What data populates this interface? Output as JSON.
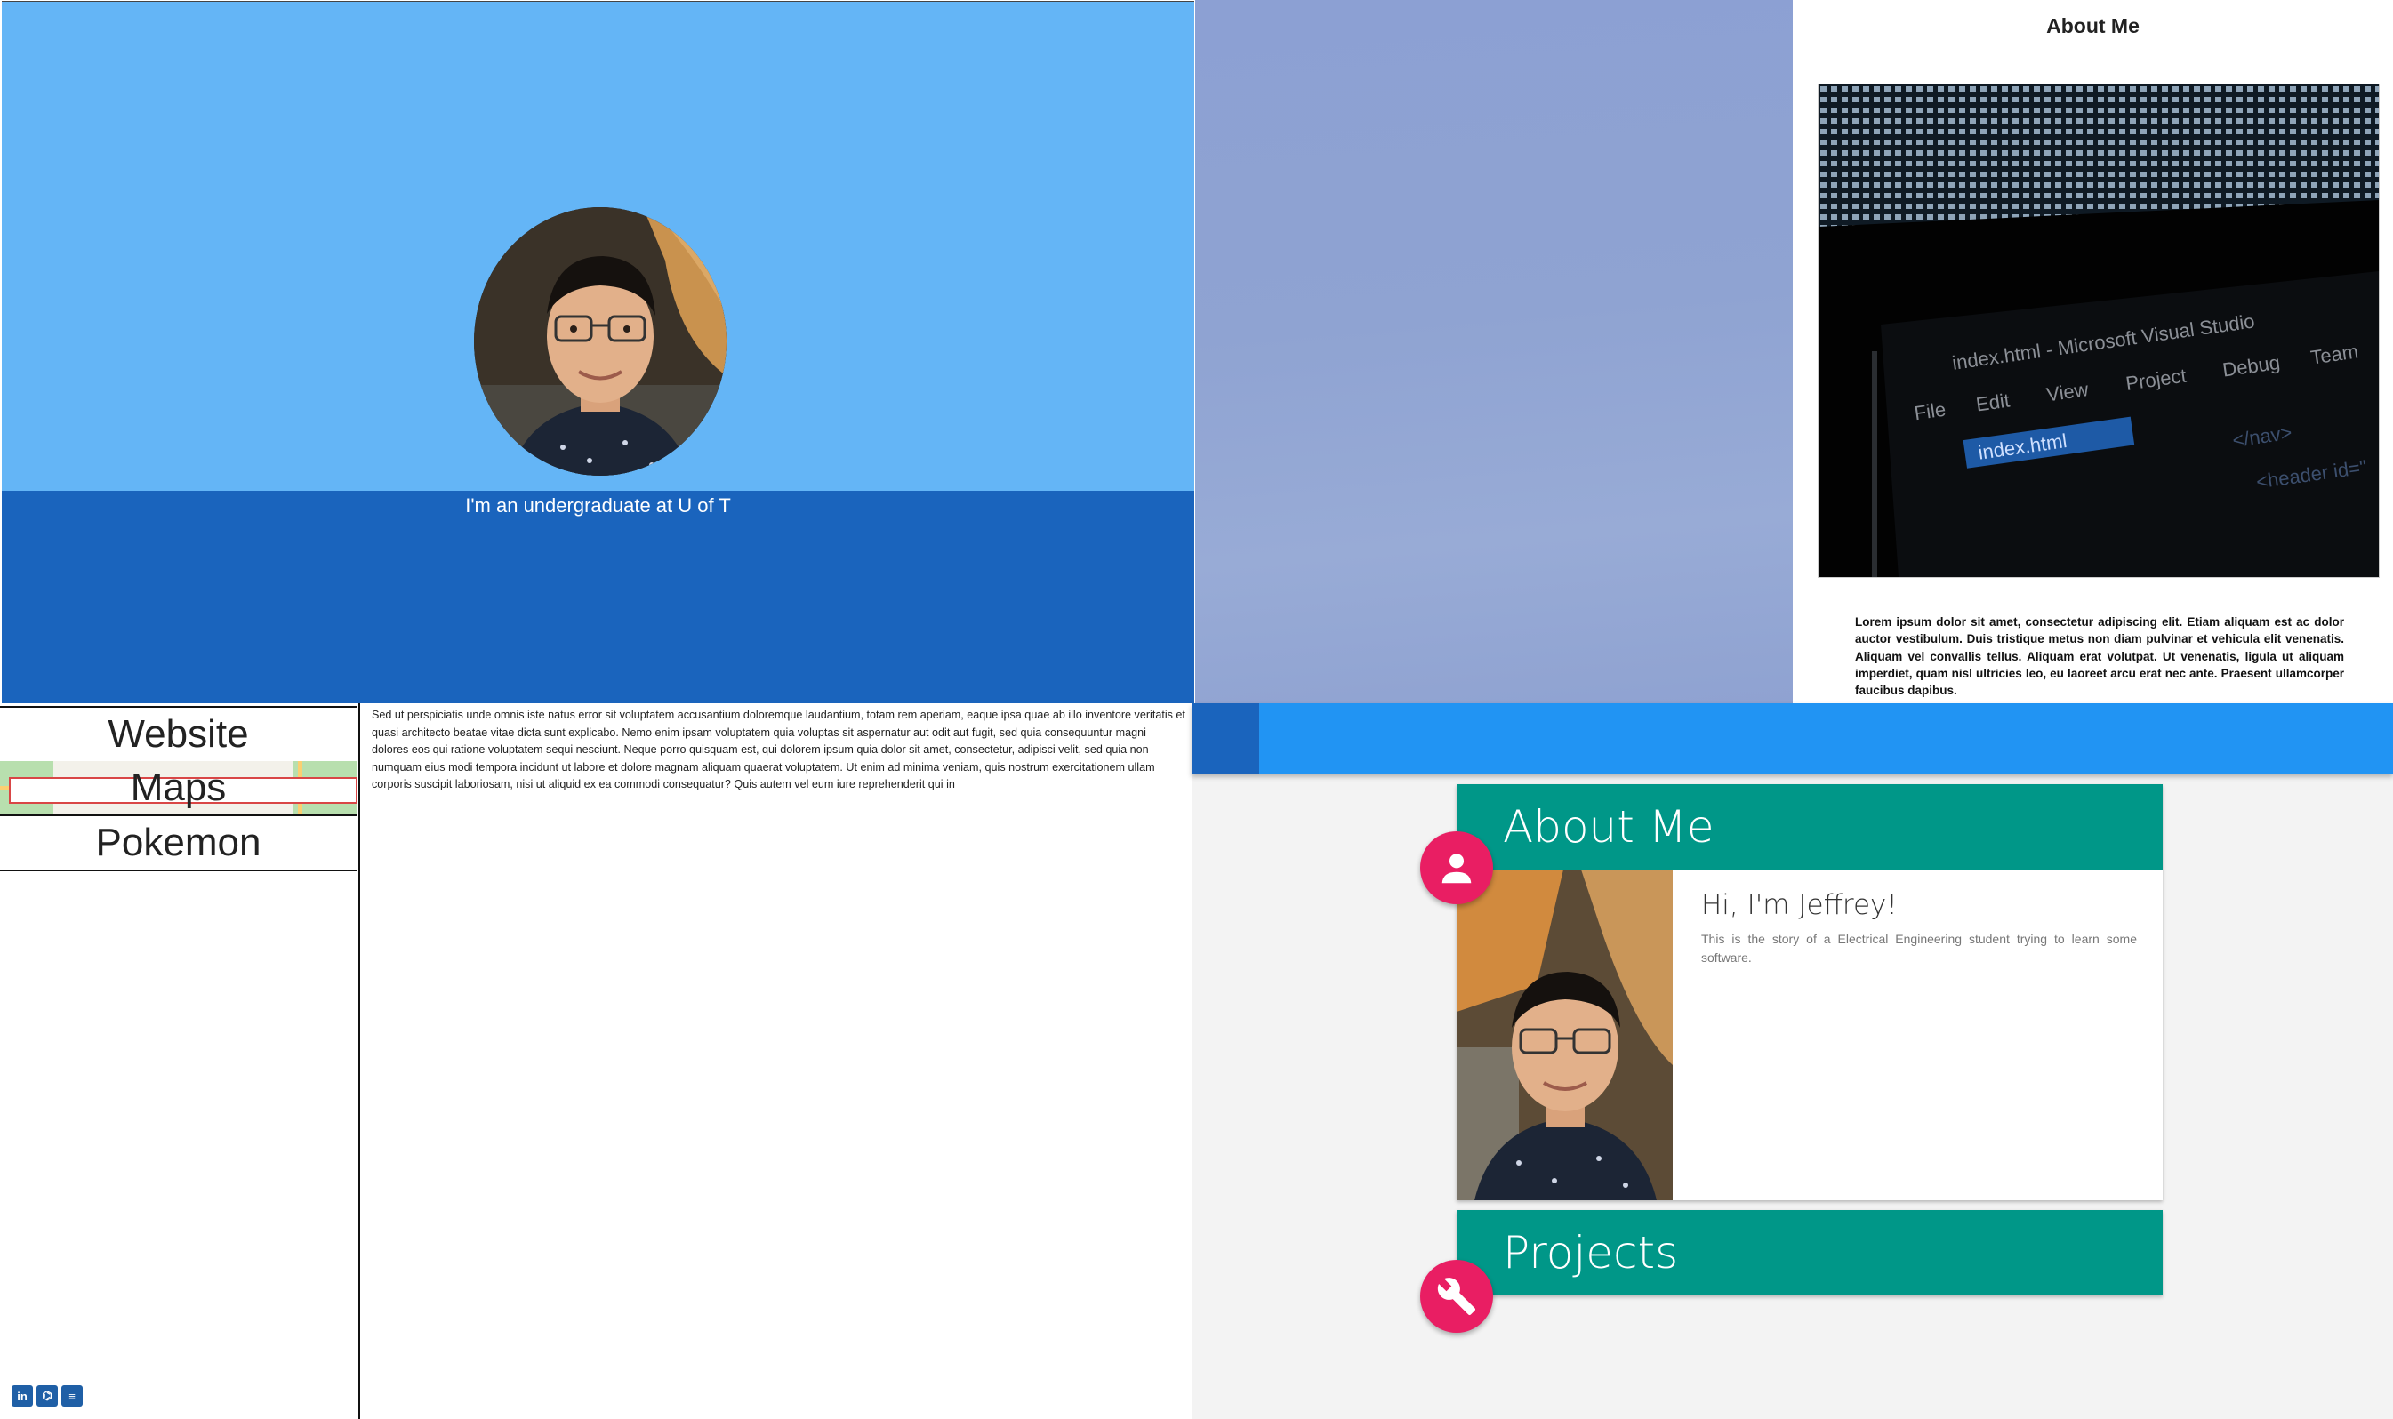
{
  "hero": {
    "caption": "I'm an undergraduate at U of T",
    "colors": {
      "top": "#64b5f6",
      "bottom": "#1a64bd"
    }
  },
  "about_panel": {
    "title": "About Me",
    "photo_icon": "visual-studio-screen-photo",
    "lorem": "Lorem ipsum dolor sit amet, consectetur adipiscing elit. Etiam aliquam est ac dolor auctor vestibulum. Duis tristique metus non diam pulvinar et vehicula elit venenatis. Aliquam vel convallis tellus. Aliquam erat volutpat. Ut venenatis, ligula ut aliquam imperdiet, quam nisl ultricies leo, eu laoreet arcu erat nec ante. Praesent ullamcorper faucibus dapibus.",
    "photo_text": {
      "title": "index.html - Microsoft Visual Studio",
      "menu": [
        "File",
        "Edit",
        "View",
        "Project",
        "Debug",
        "Team"
      ],
      "tab": "index.html"
    }
  },
  "sidebar": {
    "items": [
      {
        "label": "Website"
      },
      {
        "label": "Maps"
      },
      {
        "label": "Pokemon"
      }
    ],
    "social": [
      {
        "name": "linkedin-icon",
        "glyph": "in"
      },
      {
        "name": "github-icon",
        "glyph": "⌬"
      },
      {
        "name": "resume-icon",
        "glyph": "≡"
      }
    ]
  },
  "body_text": "Sed ut perspiciatis unde omnis iste natus error sit voluptatem accusantium doloremque laudantium, totam rem aperiam, eaque ipsa quae ab illo inventore veritatis et quasi architecto beatae vitae dicta sunt explicabo. Nemo enim ipsam voluptatem quia voluptas sit aspernatur aut odit aut fugit, sed quia consequuntur magni dolores eos qui ratione voluptatem sequi nesciunt. Neque porro quisquam est, qui dolorem ipsum quia dolor sit amet, consectetur, adipisci velit, sed quia non numquam eius modi tempora incidunt ut labore et dolore magnam aliquam quaerat voluptatem. Ut enim ad minima veniam, quis nostrum exercitationem ullam corporis suscipit laboriosam, nisi ut aliquid ex ea commodi consequatur? Quis autem vel eum iure reprehenderit qui in",
  "material": {
    "about_card": {
      "title": "About Me",
      "greeting": "Hi, I'm Jeffrey!",
      "story": "This is the story of a Electrical Engineering student trying to learn some software.",
      "icon": "person-icon"
    },
    "projects_card": {
      "title": "Projects",
      "icon": "wrench-icon"
    },
    "colors": {
      "app_bar": "#2194f3",
      "card_header": "#009788",
      "fab": "#e91e63",
      "background": "#f3f3f3"
    }
  }
}
